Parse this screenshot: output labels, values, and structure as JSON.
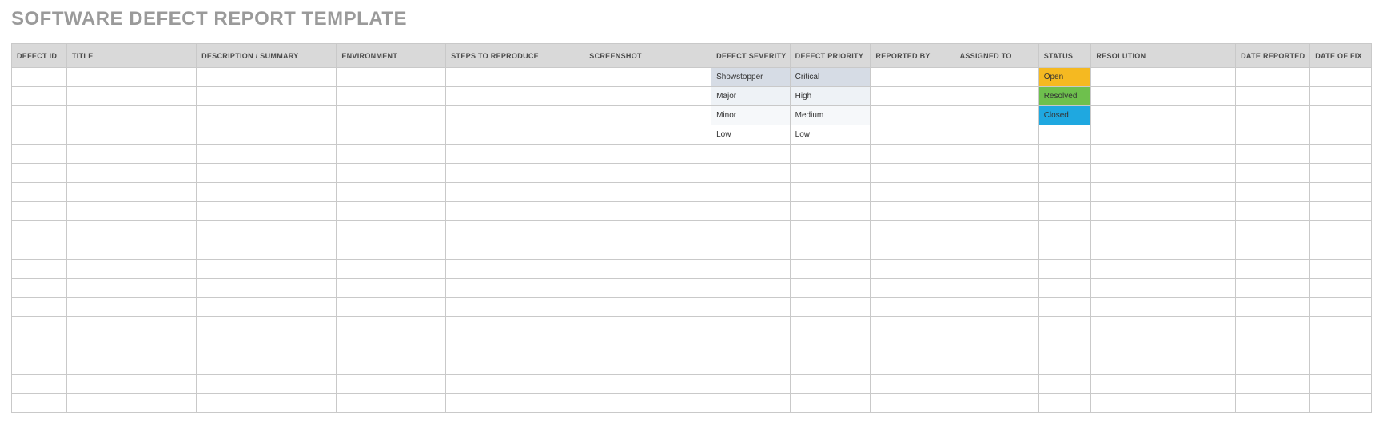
{
  "title": "SOFTWARE DEFECT REPORT TEMPLATE",
  "columns": [
    "DEFECT ID",
    "TITLE",
    "DESCRIPTION / SUMMARY",
    "ENVIRONMENT",
    "STEPS TO REPRODUCE",
    "SCREENSHOT",
    "DEFECT SEVERITY",
    "DEFECT PRIORITY",
    "REPORTED BY",
    "ASSIGNED TO",
    "STATUS",
    "RESOLUTION",
    "DATE REPORTED",
    "DATE OF FIX"
  ],
  "rows": [
    {
      "severity": "Showstopper",
      "priority": "Critical",
      "status": "Open"
    },
    {
      "severity": "Major",
      "priority": "High",
      "status": "Resolved"
    },
    {
      "severity": "Minor",
      "priority": "Medium",
      "status": "Closed"
    },
    {
      "severity": "Low",
      "priority": "Low",
      "status": ""
    },
    {
      "severity": "",
      "priority": "",
      "status": ""
    },
    {
      "severity": "",
      "priority": "",
      "status": ""
    },
    {
      "severity": "",
      "priority": "",
      "status": ""
    },
    {
      "severity": "",
      "priority": "",
      "status": ""
    },
    {
      "severity": "",
      "priority": "",
      "status": ""
    },
    {
      "severity": "",
      "priority": "",
      "status": ""
    },
    {
      "severity": "",
      "priority": "",
      "status": ""
    },
    {
      "severity": "",
      "priority": "",
      "status": ""
    },
    {
      "severity": "",
      "priority": "",
      "status": ""
    },
    {
      "severity": "",
      "priority": "",
      "status": ""
    },
    {
      "severity": "",
      "priority": "",
      "status": ""
    },
    {
      "severity": "",
      "priority": "",
      "status": ""
    },
    {
      "severity": "",
      "priority": "",
      "status": ""
    },
    {
      "severity": "",
      "priority": "",
      "status": ""
    }
  ]
}
